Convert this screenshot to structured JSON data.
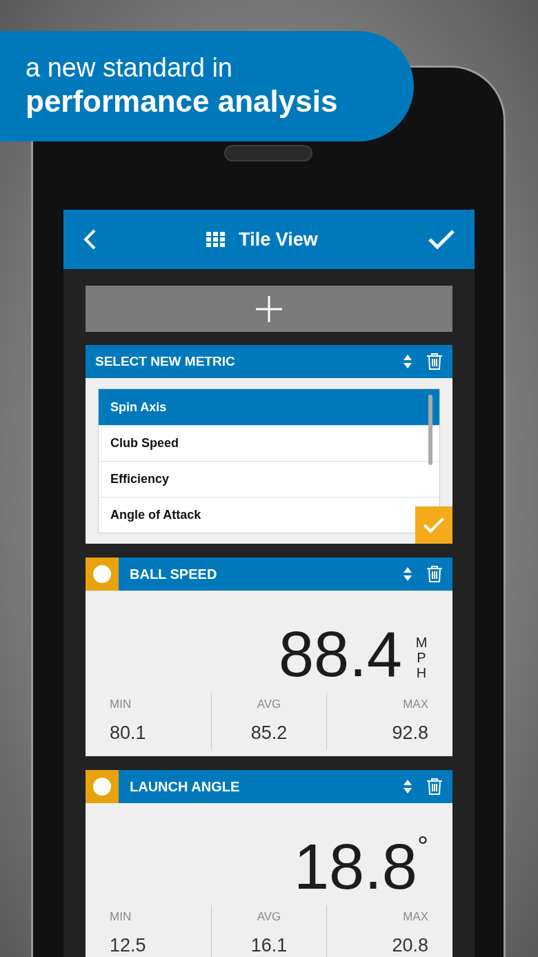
{
  "banner": {
    "line_1": "a new standard in",
    "line_2": "performance analysis"
  },
  "header": {
    "title": "Tile View"
  },
  "metric_picker": {
    "title": "SELECT NEW METRIC",
    "options": [
      {
        "label": "Spin Axis",
        "selected": true
      },
      {
        "label": "Club Speed",
        "selected": false
      },
      {
        "label": "Efficiency",
        "selected": false
      },
      {
        "label": "Angle of Attack",
        "selected": false
      }
    ]
  },
  "tiles": [
    {
      "title": "BALL SPEED",
      "value": "88.4",
      "unit": "MPH",
      "kind": "stacked",
      "stats": [
        {
          "label": "MIN",
          "value": "80.1"
        },
        {
          "label": "AVG",
          "value": "85.2"
        },
        {
          "label": "MAX",
          "value": "92.8"
        }
      ]
    },
    {
      "title": "LAUNCH ANGLE",
      "value": "18.8",
      "unit": "°",
      "kind": "superscript",
      "stats": [
        {
          "label": "MIN",
          "value": "12.5"
        },
        {
          "label": "AVG",
          "value": "16.1"
        },
        {
          "label": "MAX",
          "value": "20.8"
        }
      ]
    }
  ]
}
